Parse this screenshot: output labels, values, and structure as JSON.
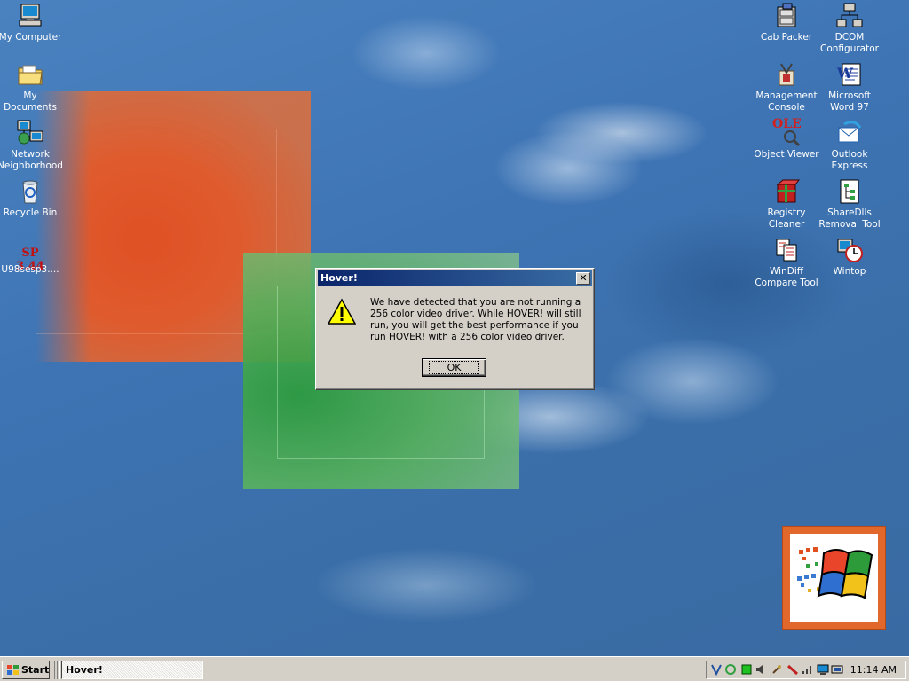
{
  "desktop": {
    "left_icons": [
      {
        "label": "My Computer"
      },
      {
        "label": "My\nDocuments"
      },
      {
        "label": "Network\nNeighborhood"
      },
      {
        "label": "Recycle Bin"
      },
      {
        "label": "U98sesp3....",
        "art_text": "SP\n3.44"
      }
    ],
    "right_icons": [
      {
        "label": "Cab Packer"
      },
      {
        "label": "DCOM\nConfigurator"
      },
      {
        "label": "Management\nConsole"
      },
      {
        "label": "Microsoft\nWord 97"
      },
      {
        "label": "Object Viewer",
        "art_text": "OLE"
      },
      {
        "label": "Outlook\nExpress"
      },
      {
        "label": "Registry\nCleaner"
      },
      {
        "label": "ShareDlls\nRemoval Tool"
      },
      {
        "label": "WinDiff\nCompare Tool"
      },
      {
        "label": "Wintop"
      }
    ]
  },
  "dialog": {
    "title": "Hover!",
    "close_glyph": "✕",
    "icon": "warning-icon",
    "message": "We have detected that you are not running a 256 color video driver.  While HOVER! will still run, you will get the best performance if you run HOVER! with a 256 color video driver.",
    "ok_label": "OK"
  },
  "taskbar": {
    "start_label": "Start",
    "task_label": "Hover!",
    "clock": "11:14 AM"
  },
  "colors": {
    "desktop_bg": "#3a6ea5",
    "titlebar_start": "#0a246a",
    "titlebar_end": "#3a6ea5",
    "face": "#d4d0c8"
  }
}
